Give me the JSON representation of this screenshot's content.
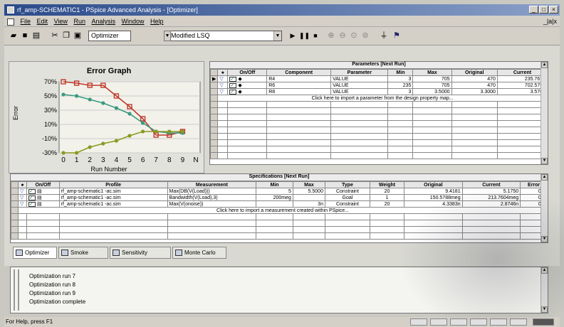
{
  "window": {
    "title": "rf_amp-SCHEMATIC1 - PSpice Advanced Analysis - [Optimizer]",
    "min": "_",
    "max": "□",
    "close": "×",
    "child_controls": "_|a|x"
  },
  "menu": [
    "File",
    "Edit",
    "View",
    "Run",
    "Analysis",
    "Window",
    "Help"
  ],
  "toolbar": {
    "tool_select": "Optimizer",
    "engine_select": "Modified LSQ"
  },
  "graph": {
    "title": "Error Graph",
    "ylabel": "Error",
    "xlabel": "Run Number",
    "y_ticks": [
      "70%",
      "50%",
      "30%",
      "10%",
      "-10%",
      "-30%"
    ],
    "x_ticks": [
      "0",
      "1",
      "2",
      "3",
      "4",
      "5",
      "6",
      "7",
      "8",
      "9",
      "N"
    ]
  },
  "chart_data": {
    "type": "line",
    "title": "Error Graph",
    "xlabel": "Run Number",
    "ylabel": "Error",
    "x": [
      0,
      1,
      2,
      3,
      4,
      5,
      6,
      7,
      8,
      9
    ],
    "ylim": [
      -30,
      70
    ],
    "series": [
      {
        "color": "#c0392b",
        "marker": "square",
        "values": [
          70,
          68,
          65,
          65,
          50,
          35,
          18,
          -5,
          -5,
          0
        ]
      },
      {
        "color": "#3a9a80",
        "marker": "circle",
        "values": [
          52,
          50,
          45,
          40,
          33,
          25,
          12,
          0,
          -2,
          -2
        ]
      },
      {
        "color": "#8a9a20",
        "marker": "circle",
        "values": [
          -30,
          -30,
          -22,
          -17,
          -13,
          -6,
          0,
          0,
          0,
          0
        ]
      }
    ]
  },
  "parameters": {
    "caption": "Parameters [Next Run]",
    "headers": [
      "On/Off",
      "Component",
      "Parameter",
      "Min",
      "Max",
      "Original",
      "Current"
    ],
    "rows": [
      {
        "component": "R4",
        "parameter": "VALUE",
        "min": "3",
        "max": "705",
        "original": "470",
        "current": "235.7673"
      },
      {
        "component": "R6",
        "parameter": "VALUE",
        "min": "235",
        "max": "705",
        "original": "470",
        "current": "702.5752"
      },
      {
        "component": "R8",
        "parameter": "VALUE",
        "min": "3",
        "max": "3.5000",
        "original": "3.3000",
        "current": "3.5700"
      }
    ],
    "import_text": "Click here to import a parameter from the design property map..."
  },
  "specifications": {
    "caption": "Specifications [Next Run]",
    "headers": [
      "On/Off",
      "Profile",
      "Measurement",
      "Min",
      "Max",
      "Type",
      "Weight",
      "Original",
      "Current",
      "Error"
    ],
    "rows": [
      {
        "profile": "rf_amp-schematic1 -ac.sim",
        "measurement": "Max(DB(V(Load)))",
        "min": "5",
        "max": "5.5000",
        "type": "Constraint",
        "weight": "20",
        "original": "9.4181",
        "current": "5.1750",
        "error": "0%"
      },
      {
        "profile": "rf_amp-schematic1 -ac.sim",
        "measurement": "Bandwidth(V(Load),3)",
        "min": "200meg",
        "max": "",
        "type": "Goal",
        "weight": "1",
        "original": "150.5788meg",
        "current": "213.7604meg",
        "error": "0%"
      },
      {
        "profile": "rf_amp-schematic1 -ac.sim",
        "measurement": "Max(V(onoise))",
        "min": "",
        "max": "3n",
        "type": "Constraint",
        "weight": "20",
        "original": "4.3383n",
        "current": "2.8746n",
        "error": "0%"
      }
    ],
    "import_text": "Click here to import a measurement created within PSpice..."
  },
  "tabs": [
    "Optimizer",
    "Smoke",
    "Sensitivity",
    "Monte Carlo"
  ],
  "output": [
    "Optimization run 7",
    "Optimization run 8",
    "Optimization run 9",
    "Optimization complete"
  ],
  "status": "For Help, press F1",
  "colors": {
    "title_bar": "#2a4a8a",
    "check": "#2e7a3a"
  }
}
